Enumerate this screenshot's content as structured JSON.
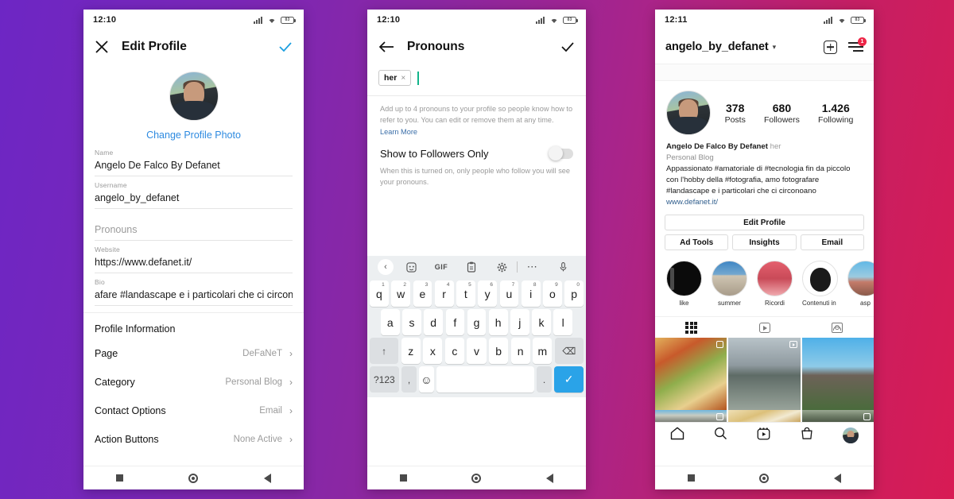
{
  "background": {
    "from": "#6d26c4",
    "mid": "#8b27a2",
    "to": "#d81b54"
  },
  "phone1": {
    "status": {
      "time": "12:10",
      "battery": "83"
    },
    "appbar": {
      "close_icon": "close-icon",
      "title": "Edit Profile",
      "confirm_icon": "check-icon"
    },
    "avatar_alt": "profile-photo",
    "change_photo_label": "Change Profile Photo",
    "fields": [
      {
        "label": "Name",
        "value": "Angelo De Falco  By Defanet",
        "placeholder": ""
      },
      {
        "label": "Username",
        "value": "angelo_by_defanet",
        "placeholder": ""
      },
      {
        "label": "",
        "value": "",
        "placeholder": "Pronouns"
      },
      {
        "label": "Website",
        "value": "https://www.defanet.it/",
        "placeholder": ""
      },
      {
        "label": "Bio",
        "value": "afare #landascape e i particolari che ci circonoano",
        "placeholder": ""
      }
    ],
    "section_header": "Profile Information",
    "rows": [
      {
        "label": "Page",
        "value": "DeFaNeT"
      },
      {
        "label": "Category",
        "value": "Personal Blog"
      },
      {
        "label": "Contact Options",
        "value": "Email"
      },
      {
        "label": "Action Buttons",
        "value": "None Active"
      }
    ]
  },
  "phone2": {
    "status": {
      "time": "12:10",
      "battery": "83"
    },
    "appbar": {
      "back_icon": "arrow-left-icon",
      "title": "Pronouns",
      "confirm_icon": "check-icon"
    },
    "chip": {
      "label": "her",
      "remove": "×"
    },
    "helper_text": "Add up to 4 pronouns to your profile so people know how to refer to you. You can edit or remove them at any time. ",
    "helper_link": "Learn More",
    "toggle": {
      "label": "Show to Followers Only",
      "state": "off"
    },
    "toggle_help": "When this is turned on, only people who follow you will see your pronouns.",
    "keyboard": {
      "toolbar": [
        "chevron-left-icon",
        "sticker-icon",
        "GIF",
        "clipboard-icon",
        "gear-icon",
        "more-icon",
        "mic-icon"
      ],
      "row1": [
        {
          "k": "q",
          "n": "1"
        },
        {
          "k": "w",
          "n": "2"
        },
        {
          "k": "e",
          "n": "3"
        },
        {
          "k": "r",
          "n": "4"
        },
        {
          "k": "t",
          "n": "5"
        },
        {
          "k": "y",
          "n": "6"
        },
        {
          "k": "u",
          "n": "7"
        },
        {
          "k": "i",
          "n": "8"
        },
        {
          "k": "o",
          "n": "9"
        },
        {
          "k": "p",
          "n": "0"
        }
      ],
      "row2": [
        "a",
        "s",
        "d",
        "f",
        "g",
        "h",
        "j",
        "k",
        "l"
      ],
      "row3": [
        "z",
        "x",
        "c",
        "v",
        "b",
        "n",
        "m"
      ],
      "shift": "↑",
      "backspace": "⌫",
      "numbers": "?123",
      "comma": ",",
      "emoji": "☺",
      "space": "",
      "period": ".",
      "enter": "✓"
    }
  },
  "phone3": {
    "status": {
      "time": "12:11",
      "battery": "83"
    },
    "username": "angelo_by_defanet",
    "notification_count": "1",
    "stats": [
      {
        "n": "378",
        "t": "Posts"
      },
      {
        "n": "680",
        "t": "Followers"
      },
      {
        "n": "1.426",
        "t": "Following"
      }
    ],
    "bio": {
      "name": "Angelo De Falco  By Defanet",
      "pronoun": "her",
      "category": "Personal Blog",
      "text": "Appassionato #amatoriale di #tecnologia fin da piccolo con l'hobby della #fotografia, amo fotografare #landascape e i particolari che ci circonoano",
      "link": "www.defanet.it/"
    },
    "buttons": {
      "edit": "Edit Profile",
      "ad_tools": "Ad Tools",
      "insights": "Insights",
      "email": "Email"
    },
    "highlights": [
      {
        "name": "like"
      },
      {
        "name": "summer"
      },
      {
        "name": "Ricordi"
      },
      {
        "name": "Contenuti in evi"
      },
      {
        "name": "asp"
      }
    ],
    "tabs": [
      "grid-icon",
      "reels-icon",
      "tagged-icon"
    ],
    "tabbar": [
      "home-icon",
      "search-icon",
      "reels-icon",
      "shop-icon",
      "profile-avatar"
    ]
  }
}
